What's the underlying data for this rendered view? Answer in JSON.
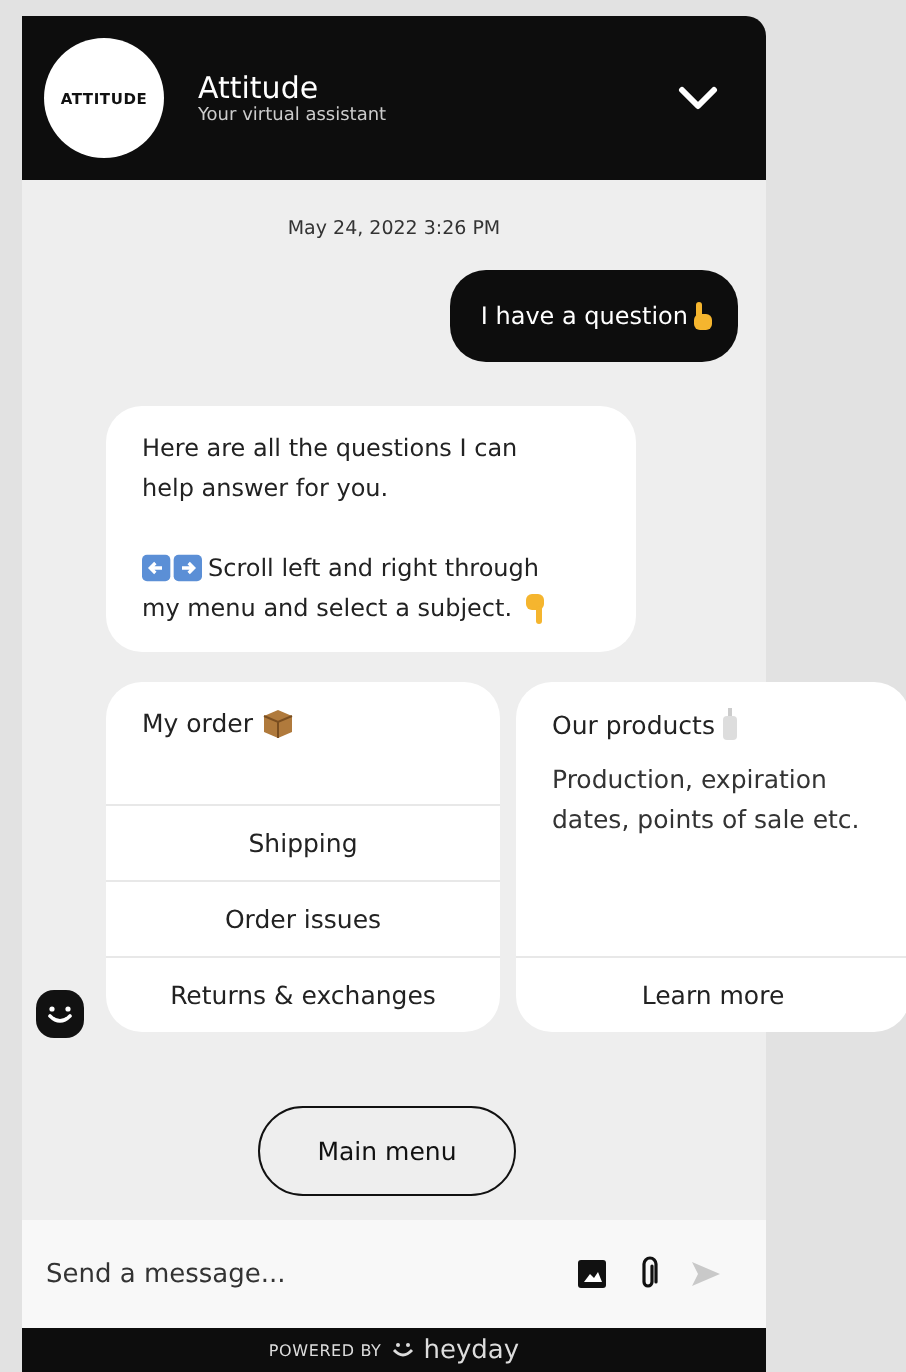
{
  "header": {
    "logo_text": "ATTITUDE",
    "title": "Attitude",
    "subtitle": "Your virtual assistant"
  },
  "timestamp": "May 24, 2022 3:26 PM",
  "user_message": "I have a question",
  "bot_message": {
    "line_1": "Here are all the questions I can help answer for you.",
    "line_2": "Scroll left and right through",
    "line_3": "my menu and select a subject."
  },
  "cards": [
    {
      "title": "My order",
      "kind": "options",
      "options": [
        "Shipping",
        "Order issues",
        "Returns & exchanges"
      ]
    },
    {
      "title": "Our products",
      "kind": "description",
      "description": "Production, expiration dates, points of sale etc.",
      "options": [
        "Learn more"
      ]
    }
  ],
  "main_menu_button": "Main menu",
  "composer": {
    "placeholder": "Send a message..."
  },
  "footer": {
    "powered_by": "POWERED BY",
    "brand": "heyday"
  }
}
